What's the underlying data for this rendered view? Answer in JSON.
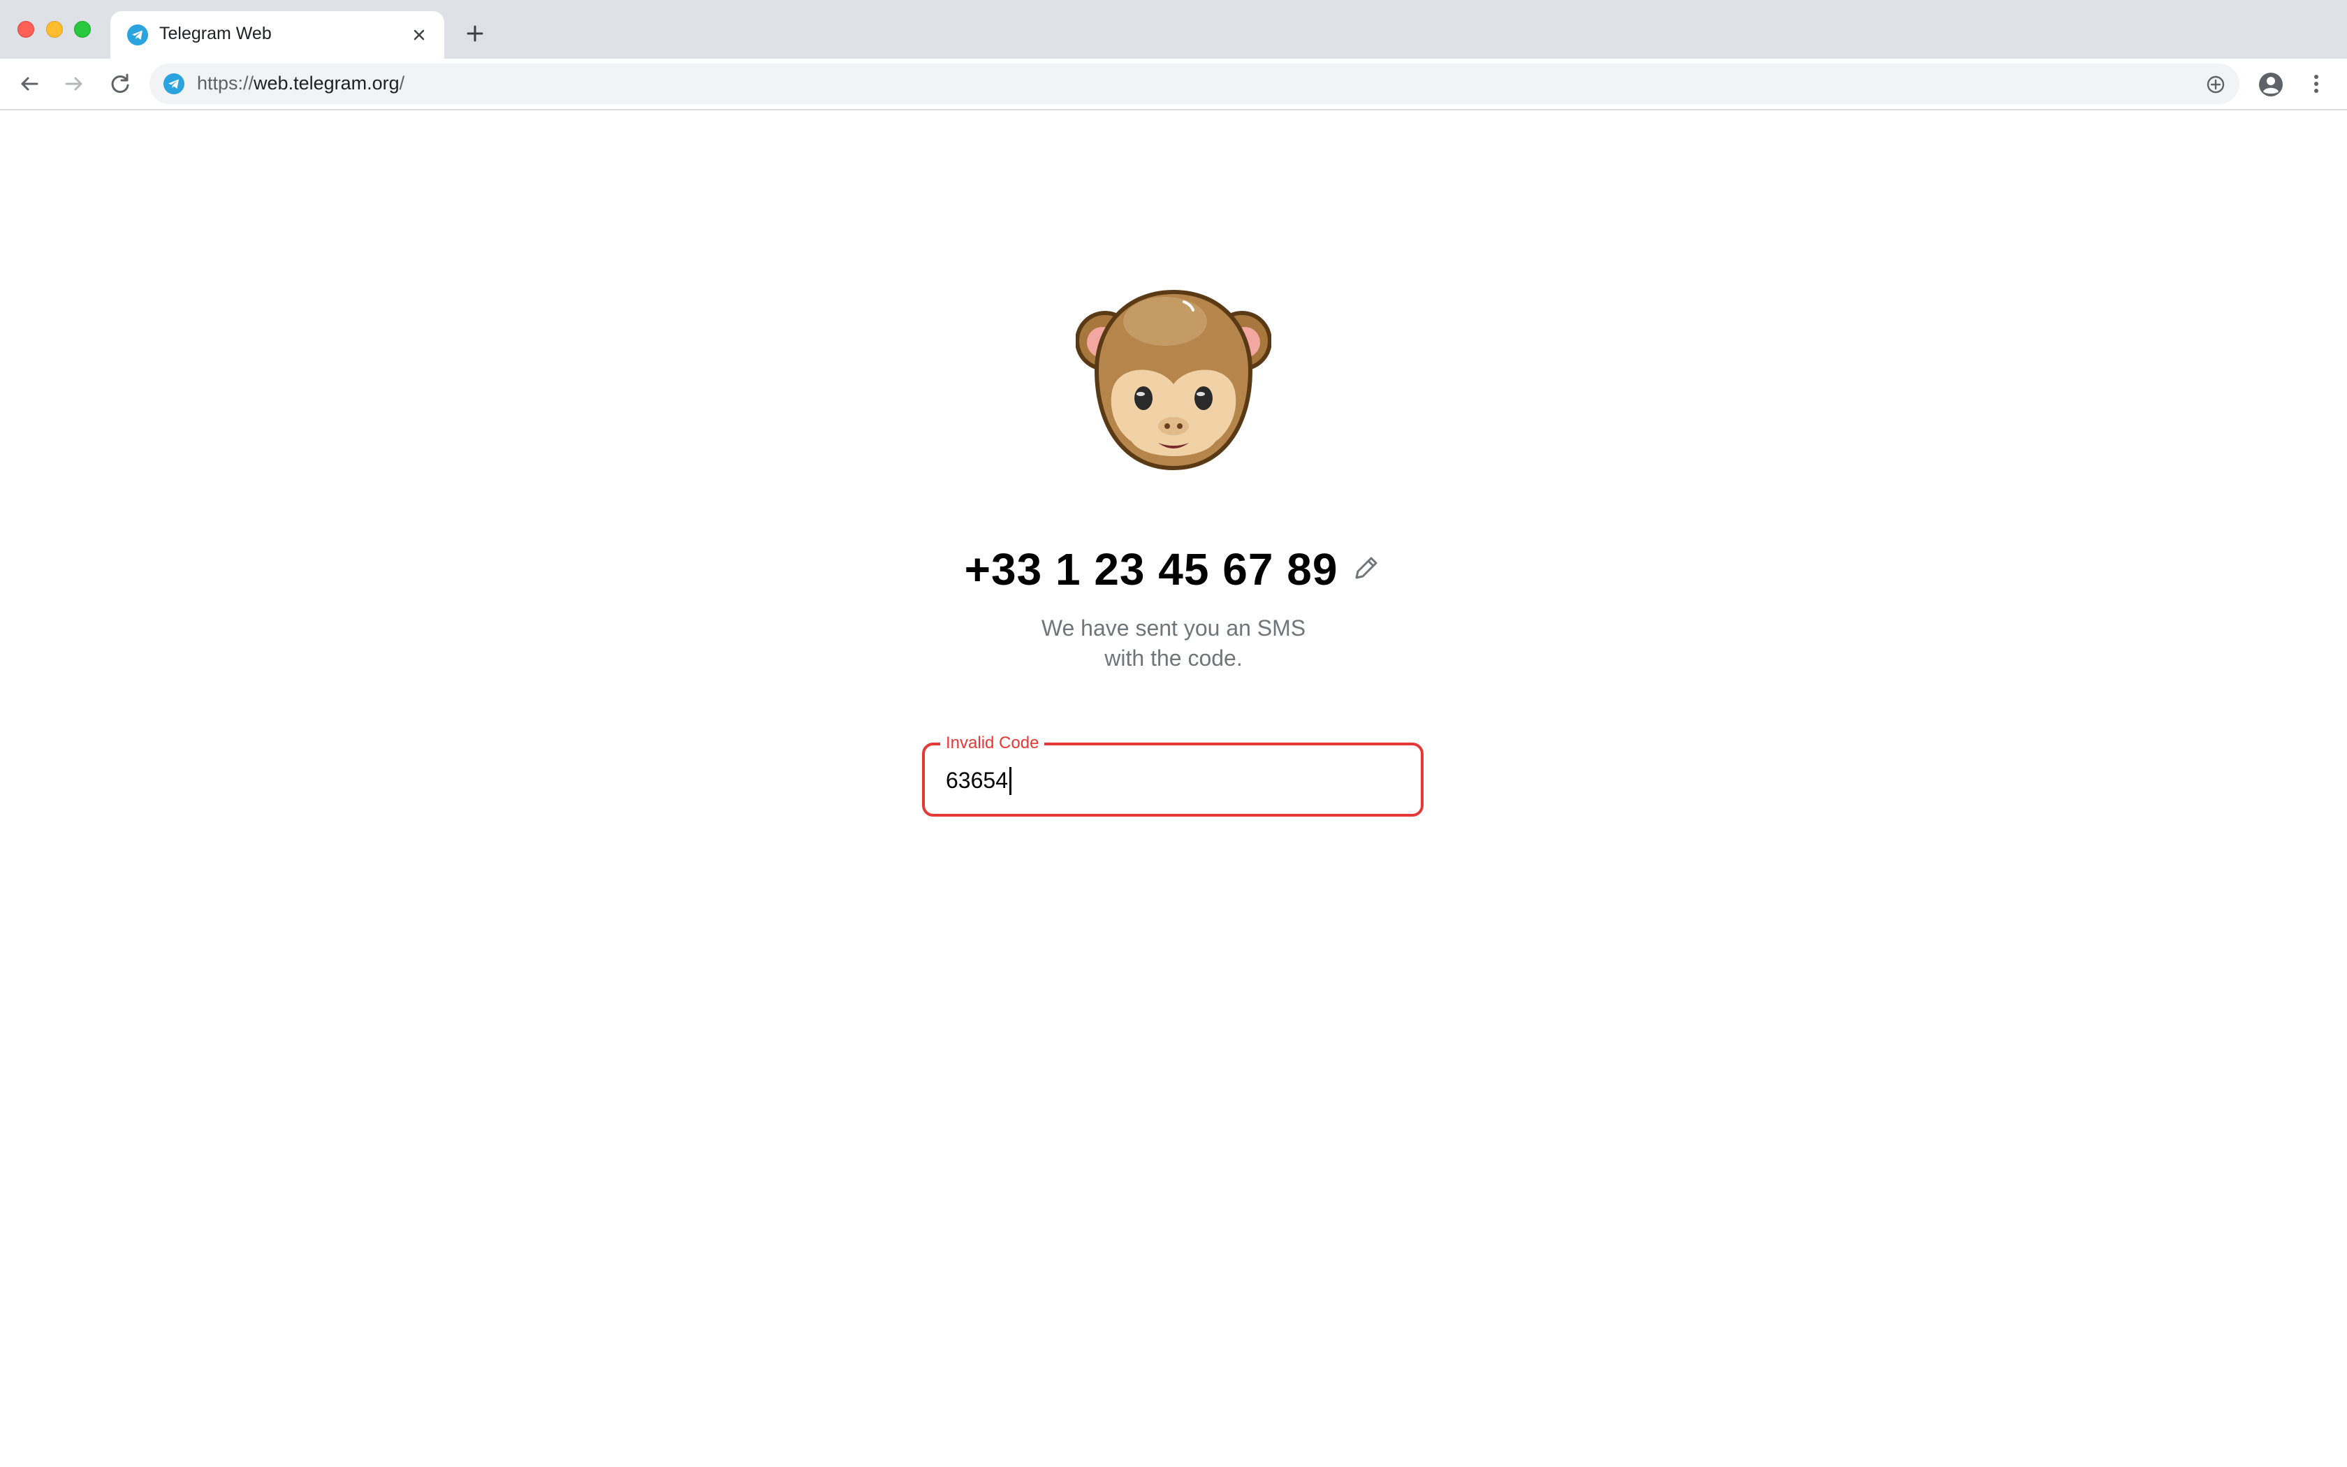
{
  "browser": {
    "tab": {
      "title": "Telegram Web",
      "favicon": "telegram-icon"
    },
    "address_bar": {
      "scheme": "https://",
      "host": "web.telegram.org",
      "path": "/"
    },
    "icons": {
      "back": "arrow-left-icon",
      "forward": "arrow-right-icon",
      "reload": "reload-icon",
      "install": "install-app-icon",
      "profile": "account-icon",
      "menu": "more-vertical-icon",
      "new_tab": "plus-icon",
      "close_tab": "close-icon"
    }
  },
  "auth": {
    "avatar": "monkey-icon",
    "phone_number": "+33 1 23 45 67 89",
    "edit_icon": "pencil-icon",
    "message_line1": "We have sent you an SMS",
    "message_line2": "with the code.",
    "code_field": {
      "label": "Invalid Code",
      "value": "63654",
      "state": "error"
    }
  },
  "colors": {
    "error": "#e53935",
    "telegram_blue": "#2aa3df",
    "subtitle": "#707579",
    "tabbar_bg": "#dee1e6",
    "omnibox_bg": "#f1f3f4"
  }
}
